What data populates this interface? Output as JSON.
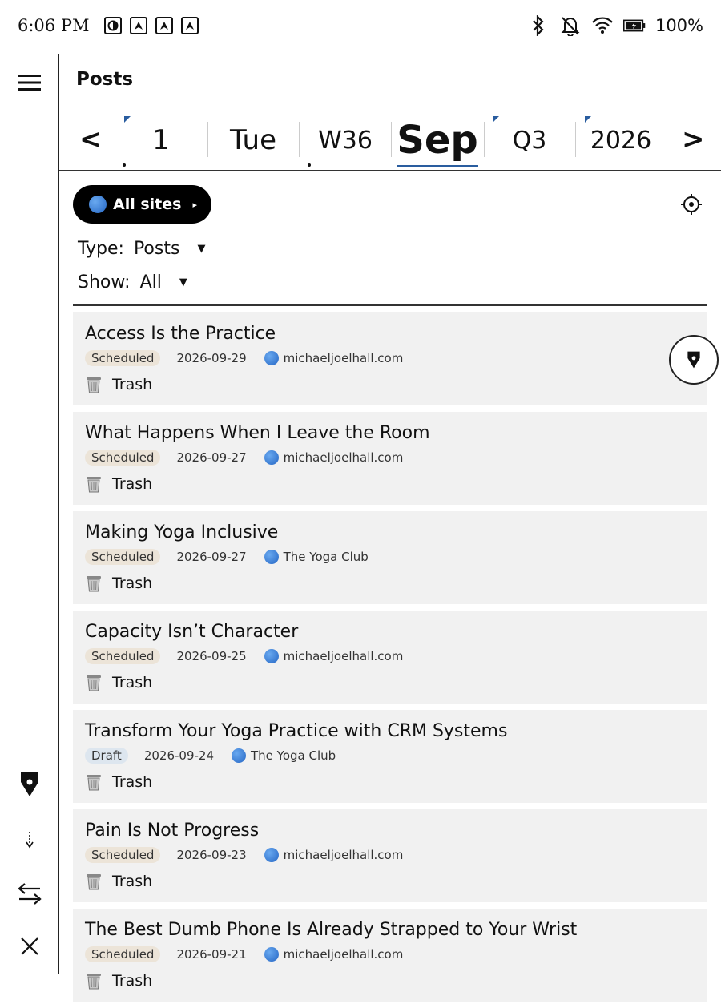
{
  "status_bar": {
    "time": "6:06 PM",
    "battery_text": "100%",
    "notification_icons": [
      "circle-half-icon",
      "arrow-up-icon",
      "arrow-up-icon",
      "arrow-up-icon"
    ],
    "right_icons": [
      "bluetooth-icon",
      "bell-off-icon",
      "wifi-icon",
      "battery-charging-icon"
    ]
  },
  "header": {
    "title": "Posts"
  },
  "date_nav": {
    "prev": "<",
    "next": ">",
    "segments": [
      {
        "label": "1",
        "flagged": true
      },
      {
        "label": "Tue",
        "flagged": false
      },
      {
        "label": "W36",
        "flagged": false
      },
      {
        "label": "Sep",
        "flagged": false,
        "selected": true
      },
      {
        "label": "Q3",
        "flagged": true
      },
      {
        "label": "2026",
        "flagged": true
      }
    ]
  },
  "filters": {
    "sites_button": "All sites",
    "sites_arrow": "▸",
    "type_label": "Type:",
    "type_value": "Posts",
    "show_label": "Show:",
    "show_value": "All"
  },
  "trash_label": "Trash",
  "posts": [
    {
      "title": "Access Is the Practice",
      "status": "Scheduled",
      "date": "2026-09-29",
      "site": "michaeljoelhall.com"
    },
    {
      "title": "What Happens When I Leave the Room",
      "status": "Scheduled",
      "date": "2026-09-27",
      "site": "michaeljoelhall.com"
    },
    {
      "title": "Making Yoga Inclusive",
      "status": "Scheduled",
      "date": "2026-09-27",
      "site": "The Yoga Club"
    },
    {
      "title": "Capacity Isn’t Character",
      "status": "Scheduled",
      "date": "2026-09-25",
      "site": "michaeljoelhall.com"
    },
    {
      "title": "Transform Your Yoga Practice with CRM Systems",
      "status": "Draft",
      "date": "2026-09-24",
      "site": "The Yoga Club"
    },
    {
      "title": "Pain Is Not Progress",
      "status": "Scheduled",
      "date": "2026-09-23",
      "site": "michaeljoelhall.com"
    },
    {
      "title": "The Best Dumb Phone Is Already Strapped to Your Wrist",
      "status": "Scheduled",
      "date": "2026-09-21",
      "site": "michaeljoelhall.com"
    }
  ],
  "colors": {
    "accent": "#2a5d9f",
    "scheduled_badge": "#ece4d8",
    "draft_badge": "#dde6ef",
    "card_bg": "#f1f1f1"
  },
  "rail_icons": [
    "menu-icon",
    "pen-nib-icon",
    "dotted-arrow-down-icon",
    "swap-arrows-icon",
    "close-icon"
  ]
}
